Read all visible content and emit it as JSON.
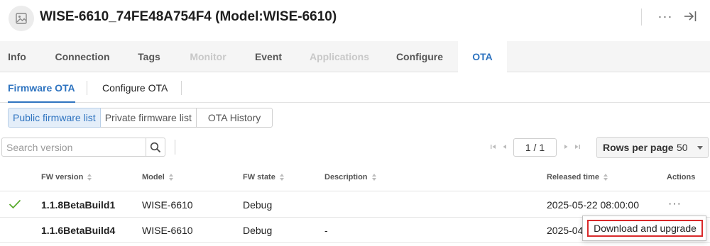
{
  "header": {
    "title": "WISE-6610_74FE48A754F4 (Model:WISE-6610)",
    "device_icon": "image-icon",
    "more_icon": "more-horizontal-icon",
    "exit_icon": "exit-icon",
    "more_label": "···"
  },
  "tabs": [
    {
      "label": "Info",
      "state": "normal"
    },
    {
      "label": "Connection",
      "state": "normal"
    },
    {
      "label": "Tags",
      "state": "normal"
    },
    {
      "label": "Monitor",
      "state": "disabled"
    },
    {
      "label": "Event",
      "state": "normal"
    },
    {
      "label": "Applications",
      "state": "disabled"
    },
    {
      "label": "Configure",
      "state": "normal"
    },
    {
      "label": "OTA",
      "state": "active"
    }
  ],
  "subtabs": [
    {
      "label": "Firmware OTA",
      "active": true
    },
    {
      "label": "Configure OTA",
      "active": false
    }
  ],
  "segments": [
    {
      "label": "Public firmware list",
      "active": true
    },
    {
      "label": "Private firmware list",
      "active": false
    },
    {
      "label": "OTA History",
      "active": false
    }
  ],
  "search": {
    "placeholder": "Search version"
  },
  "pagination": {
    "page": "1 / 1"
  },
  "rows_per_page": {
    "label": "Rows per page",
    "value": "50"
  },
  "table": {
    "columns": [
      "FW version",
      "Model",
      "FW state",
      "Description",
      "Released time",
      "Actions"
    ],
    "rows": [
      {
        "selected": true,
        "fw_version": "1.1.8BetaBuild1",
        "model": "WISE-6610",
        "fw_state": "Debug",
        "description": "",
        "released_time": "2025-05-22 08:00:00"
      },
      {
        "selected": false,
        "fw_version": "1.1.6BetaBuild4",
        "model": "WISE-6610",
        "fw_state": "Debug",
        "description": "-",
        "released_time": "2025-04"
      }
    ]
  },
  "actions_menu": {
    "item": "Download and upgrade"
  },
  "colors": {
    "accent": "#2f74c0",
    "check": "#5aab2e",
    "highlight_border": "#d9292a"
  }
}
